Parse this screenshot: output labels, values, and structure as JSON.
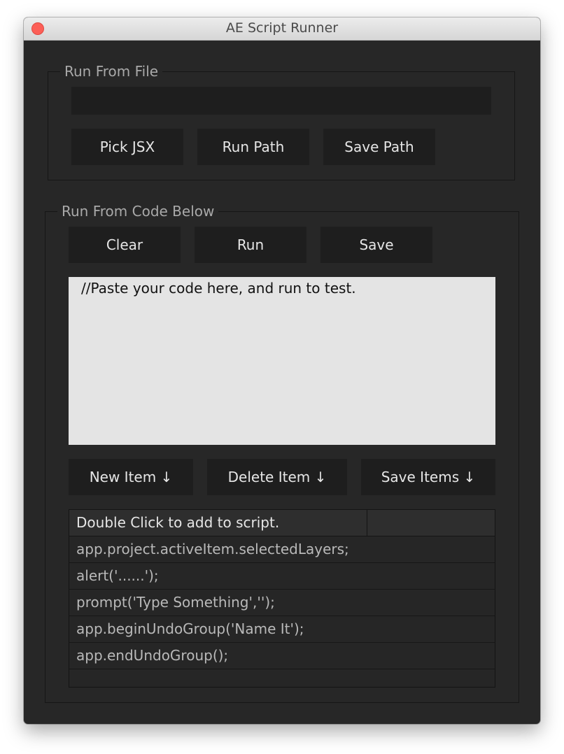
{
  "window": {
    "title": "AE Script Runner"
  },
  "run_from_file": {
    "legend": "Run From File",
    "path_value": "",
    "buttons": {
      "pick": "Pick JSX",
      "run": "Run Path",
      "save": "Save Path"
    }
  },
  "run_from_code": {
    "legend": "Run From Code Below",
    "buttons": {
      "clear": "Clear",
      "run": "Run",
      "save": "Save"
    },
    "code": "//Paste your code here, and run to test.",
    "item_buttons": {
      "new": "New Item ↓",
      "delete": "Delete Item ↓",
      "save": "Save Items ↓"
    },
    "list": {
      "header": "Double Click to add to script.",
      "items": [
        "app.project.activeItem.selectedLayers;",
        "alert('......');",
        "prompt('Type Something','');",
        "app.beginUndoGroup('Name It');",
        "app.endUndoGroup();",
        ""
      ]
    }
  },
  "colors": {
    "close": "#fc5f57",
    "panel": "#272727",
    "field": "#1e1e1e",
    "editor": "#e4e4e4"
  }
}
